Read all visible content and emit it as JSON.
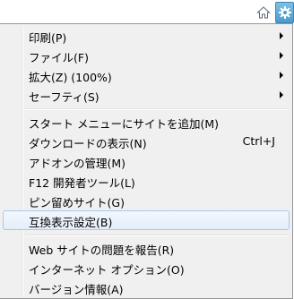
{
  "toolbar": {
    "icons": [
      "home-icon",
      "star-icon",
      "gear-icon"
    ]
  },
  "menu": {
    "group1": [
      {
        "label": "印刷(P)",
        "submenu": true
      },
      {
        "label": "ファイル(F)",
        "submenu": true
      },
      {
        "label": "拡大(Z) (100%)",
        "submenu": true
      },
      {
        "label": "セーフティ(S)",
        "submenu": true
      }
    ],
    "group2": [
      {
        "label": "スタート メニューにサイトを追加(M)",
        "shortcut": ""
      },
      {
        "label": "ダウンロードの表示(N)",
        "shortcut": "Ctrl+J"
      },
      {
        "label": "アドオンの管理(M)",
        "shortcut": ""
      },
      {
        "label": "F12 開発者ツール(L)",
        "shortcut": ""
      },
      {
        "label": "ピン留めサイト(G)",
        "shortcut": ""
      },
      {
        "label": "互換表示設定(B)",
        "shortcut": "",
        "highlighted": true
      }
    ],
    "group3": [
      {
        "label": "Web サイトの問題を報告(R)"
      },
      {
        "label": "インターネット オプション(O)"
      },
      {
        "label": "バージョン情報(A)"
      }
    ]
  },
  "colors": {
    "menu_bg": "#f0f0f0",
    "highlight_border": "#a8c8ec",
    "gear_bg": "#4a9ccc"
  }
}
